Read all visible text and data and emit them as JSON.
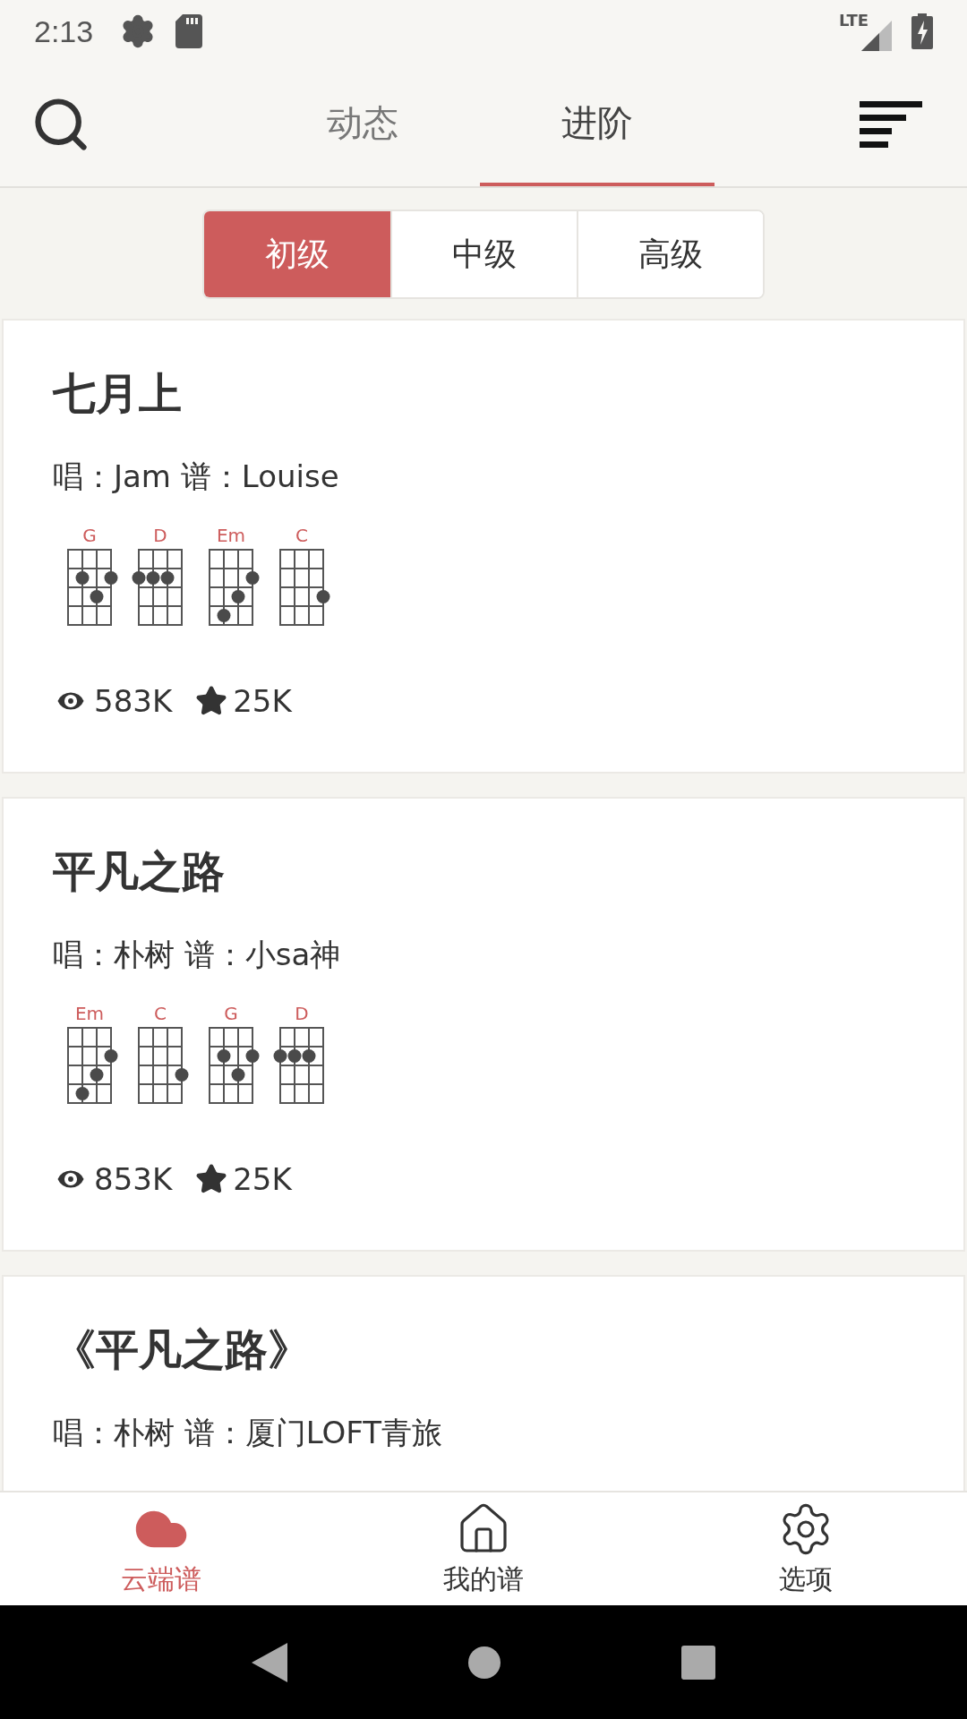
{
  "status_bar": {
    "time": "2:13",
    "network": "LTE"
  },
  "top_tabs": [
    {
      "label": "动态",
      "selected": false
    },
    {
      "label": "进阶",
      "selected": true
    }
  ],
  "level_tabs": [
    {
      "label": "初级",
      "selected": true
    },
    {
      "label": "中级",
      "selected": false
    },
    {
      "label": "高级",
      "selected": false
    }
  ],
  "songs": [
    {
      "title": "七月上",
      "credits": "唱：Jam 谱：Louise",
      "chords": [
        {
          "name": "G",
          "rows": [
            [
              false,
              false,
              false,
              false
            ],
            [
              false,
              true,
              false,
              true
            ],
            [
              false,
              false,
              true,
              false
            ],
            [
              false,
              false,
              false,
              false
            ]
          ]
        },
        {
          "name": "D",
          "rows": [
            [
              false,
              false,
              false,
              false
            ],
            [
              true,
              true,
              true,
              false
            ],
            [
              false,
              false,
              false,
              false
            ],
            [
              false,
              false,
              false,
              false
            ]
          ]
        },
        {
          "name": "Em",
          "rows": [
            [
              false,
              false,
              false,
              false
            ],
            [
              false,
              false,
              false,
              true
            ],
            [
              false,
              false,
              true,
              false
            ],
            [
              false,
              true,
              false,
              false
            ]
          ]
        },
        {
          "name": "C",
          "rows": [
            [
              false,
              false,
              false,
              false
            ],
            [
              false,
              false,
              false,
              false
            ],
            [
              false,
              false,
              false,
              true
            ],
            [
              false,
              false,
              false,
              false
            ]
          ]
        }
      ],
      "views": "583K",
      "stars": "25K"
    },
    {
      "title": "平凡之路",
      "credits": "唱：朴树 谱：小sa神",
      "chords": [
        {
          "name": "Em",
          "rows": [
            [
              false,
              false,
              false,
              false
            ],
            [
              false,
              false,
              false,
              true
            ],
            [
              false,
              false,
              true,
              false
            ],
            [
              false,
              true,
              false,
              false
            ]
          ]
        },
        {
          "name": "C",
          "rows": [
            [
              false,
              false,
              false,
              false
            ],
            [
              false,
              false,
              false,
              false
            ],
            [
              false,
              false,
              false,
              true
            ],
            [
              false,
              false,
              false,
              false
            ]
          ]
        },
        {
          "name": "G",
          "rows": [
            [
              false,
              false,
              false,
              false
            ],
            [
              false,
              true,
              false,
              true
            ],
            [
              false,
              false,
              true,
              false
            ],
            [
              false,
              false,
              false,
              false
            ]
          ]
        },
        {
          "name": "D",
          "rows": [
            [
              false,
              false,
              false,
              false
            ],
            [
              true,
              true,
              true,
              false
            ],
            [
              false,
              false,
              false,
              false
            ],
            [
              false,
              false,
              false,
              false
            ]
          ]
        }
      ],
      "views": "853K",
      "stars": "25K"
    },
    {
      "title": "《平凡之路》",
      "credits": "唱：朴树 谱：厦门LOFT青旅"
    }
  ],
  "bottom_nav": [
    {
      "label": "云端谱",
      "selected": true
    },
    {
      "label": "我的谱",
      "selected": false
    },
    {
      "label": "选项",
      "selected": false
    }
  ]
}
